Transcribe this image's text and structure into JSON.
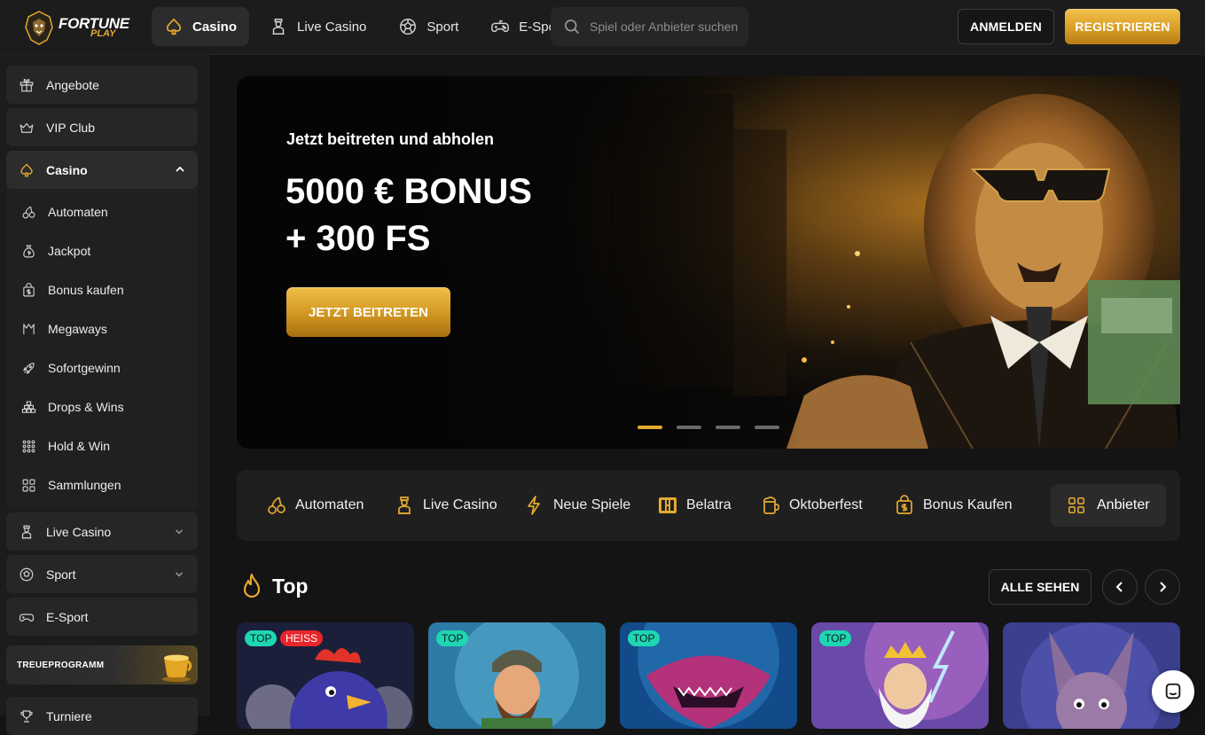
{
  "brand": {
    "name_line1": "FORTUNE",
    "name_line2": "PLAY",
    "accent": "#e5a92f"
  },
  "topnav": {
    "items": [
      {
        "label": "Casino",
        "icon": "spade-icon",
        "active": true
      },
      {
        "label": "Live Casino",
        "icon": "dealer-icon"
      },
      {
        "label": "Sport",
        "icon": "soccer-ball-icon"
      },
      {
        "label": "E-Sport",
        "icon": "gamepad-icon"
      }
    ],
    "search_placeholder": "Spiel oder Anbieter suchen",
    "login_label": "ANMELDEN",
    "register_label": "REGISTRIEREN"
  },
  "sidebar": {
    "top_items": [
      {
        "label": "Angebote",
        "icon": "gift-icon"
      },
      {
        "label": "VIP Club",
        "icon": "crown-icon"
      }
    ],
    "casino": {
      "label": "Casino",
      "expanded": true,
      "sub_items": [
        {
          "label": "Automaten",
          "icon": "cherries-icon"
        },
        {
          "label": "Jackpot",
          "icon": "money-bag-icon"
        },
        {
          "label": "Bonus kaufen",
          "icon": "bag-dollar-icon"
        },
        {
          "label": "Megaways",
          "icon": "megaways-icon"
        },
        {
          "label": "Sofortgewinn",
          "icon": "rocket-icon"
        },
        {
          "label": "Drops & Wins",
          "icon": "pyramid-icon"
        },
        {
          "label": "Hold & Win",
          "icon": "grid-dots-icon"
        },
        {
          "label": "Sammlungen",
          "icon": "collections-icon"
        }
      ]
    },
    "bottom_items": [
      {
        "label": "Live Casino",
        "icon": "dealer-icon",
        "has_chevron": true
      },
      {
        "label": "Sport",
        "icon": "soccer-ball-icon",
        "has_chevron": true
      },
      {
        "label": "E-Sport",
        "icon": "gamepad-icon",
        "has_chevron": false
      }
    ],
    "loyalty_label": "TREUEPROGRAMM",
    "tournaments_label": "Turniere"
  },
  "hero": {
    "subtitle": "Jetzt beitreten und abholen",
    "headline_line1": "5000 € BONUS",
    "headline_line2": "+ 300 FS",
    "cta_label": "JETZT BEITRETEN",
    "slides_total": 4,
    "active_slide": 1
  },
  "categories": [
    {
      "label": "Automaten",
      "icon": "cherries-icon"
    },
    {
      "label": "Live Casino",
      "icon": "dealer-icon"
    },
    {
      "label": "Neue Spiele",
      "icon": "lightning-icon"
    },
    {
      "label": "Belatra",
      "icon": "belatra-icon"
    },
    {
      "label": "Oktoberfest",
      "icon": "beer-icon"
    },
    {
      "label": "Bonus Kaufen",
      "icon": "bag-dollar-icon"
    }
  ],
  "providers_label": "Anbieter",
  "top_section": {
    "title": "Top",
    "see_all_label": "ALLE SEHEN",
    "games": [
      {
        "badges": [
          "TOP",
          "HEISS"
        ],
        "theme": "rooster"
      },
      {
        "badges": [
          "TOP"
        ],
        "theme": "fisherman"
      },
      {
        "badges": [
          "TOP"
        ],
        "theme": "shark"
      },
      {
        "badges": [
          "TOP"
        ],
        "theme": "zeus"
      },
      {
        "badges": [],
        "theme": "donkey"
      }
    ]
  }
}
